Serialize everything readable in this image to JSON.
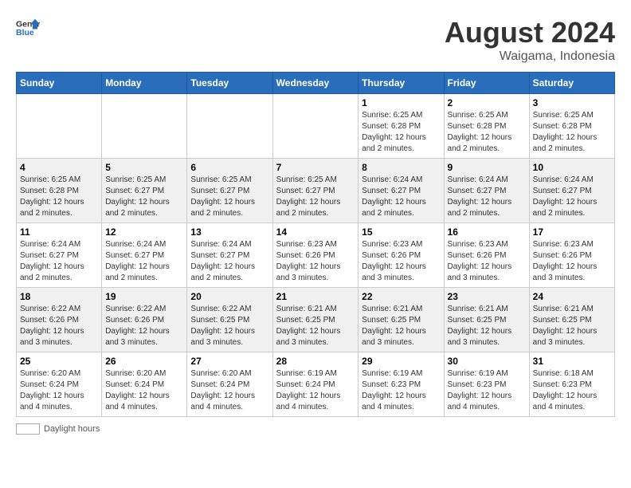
{
  "header": {
    "logo_text_general": "General",
    "logo_text_blue": "Blue",
    "month_year": "August 2024",
    "location": "Waigama, Indonesia"
  },
  "days_of_week": [
    "Sunday",
    "Monday",
    "Tuesday",
    "Wednesday",
    "Thursday",
    "Friday",
    "Saturday"
  ],
  "weeks": [
    [
      {
        "day": "",
        "sunrise": "",
        "sunset": "",
        "daylight": ""
      },
      {
        "day": "",
        "sunrise": "",
        "sunset": "",
        "daylight": ""
      },
      {
        "day": "",
        "sunrise": "",
        "sunset": "",
        "daylight": ""
      },
      {
        "day": "",
        "sunrise": "",
        "sunset": "",
        "daylight": ""
      },
      {
        "day": "1",
        "sunrise": "6:25 AM",
        "sunset": "6:28 PM",
        "daylight": "12 hours and 2 minutes."
      },
      {
        "day": "2",
        "sunrise": "6:25 AM",
        "sunset": "6:28 PM",
        "daylight": "12 hours and 2 minutes."
      },
      {
        "day": "3",
        "sunrise": "6:25 AM",
        "sunset": "6:28 PM",
        "daylight": "12 hours and 2 minutes."
      }
    ],
    [
      {
        "day": "4",
        "sunrise": "6:25 AM",
        "sunset": "6:28 PM",
        "daylight": "12 hours and 2 minutes."
      },
      {
        "day": "5",
        "sunrise": "6:25 AM",
        "sunset": "6:27 PM",
        "daylight": "12 hours and 2 minutes."
      },
      {
        "day": "6",
        "sunrise": "6:25 AM",
        "sunset": "6:27 PM",
        "daylight": "12 hours and 2 minutes."
      },
      {
        "day": "7",
        "sunrise": "6:25 AM",
        "sunset": "6:27 PM",
        "daylight": "12 hours and 2 minutes."
      },
      {
        "day": "8",
        "sunrise": "6:24 AM",
        "sunset": "6:27 PM",
        "daylight": "12 hours and 2 minutes."
      },
      {
        "day": "9",
        "sunrise": "6:24 AM",
        "sunset": "6:27 PM",
        "daylight": "12 hours and 2 minutes."
      },
      {
        "day": "10",
        "sunrise": "6:24 AM",
        "sunset": "6:27 PM",
        "daylight": "12 hours and 2 minutes."
      }
    ],
    [
      {
        "day": "11",
        "sunrise": "6:24 AM",
        "sunset": "6:27 PM",
        "daylight": "12 hours and 2 minutes."
      },
      {
        "day": "12",
        "sunrise": "6:24 AM",
        "sunset": "6:27 PM",
        "daylight": "12 hours and 2 minutes."
      },
      {
        "day": "13",
        "sunrise": "6:24 AM",
        "sunset": "6:27 PM",
        "daylight": "12 hours and 2 minutes."
      },
      {
        "day": "14",
        "sunrise": "6:23 AM",
        "sunset": "6:26 PM",
        "daylight": "12 hours and 3 minutes."
      },
      {
        "day": "15",
        "sunrise": "6:23 AM",
        "sunset": "6:26 PM",
        "daylight": "12 hours and 3 minutes."
      },
      {
        "day": "16",
        "sunrise": "6:23 AM",
        "sunset": "6:26 PM",
        "daylight": "12 hours and 3 minutes."
      },
      {
        "day": "17",
        "sunrise": "6:23 AM",
        "sunset": "6:26 PM",
        "daylight": "12 hours and 3 minutes."
      }
    ],
    [
      {
        "day": "18",
        "sunrise": "6:22 AM",
        "sunset": "6:26 PM",
        "daylight": "12 hours and 3 minutes."
      },
      {
        "day": "19",
        "sunrise": "6:22 AM",
        "sunset": "6:26 PM",
        "daylight": "12 hours and 3 minutes."
      },
      {
        "day": "20",
        "sunrise": "6:22 AM",
        "sunset": "6:25 PM",
        "daylight": "12 hours and 3 minutes."
      },
      {
        "day": "21",
        "sunrise": "6:21 AM",
        "sunset": "6:25 PM",
        "daylight": "12 hours and 3 minutes."
      },
      {
        "day": "22",
        "sunrise": "6:21 AM",
        "sunset": "6:25 PM",
        "daylight": "12 hours and 3 minutes."
      },
      {
        "day": "23",
        "sunrise": "6:21 AM",
        "sunset": "6:25 PM",
        "daylight": "12 hours and 3 minutes."
      },
      {
        "day": "24",
        "sunrise": "6:21 AM",
        "sunset": "6:25 PM",
        "daylight": "12 hours and 3 minutes."
      }
    ],
    [
      {
        "day": "25",
        "sunrise": "6:20 AM",
        "sunset": "6:24 PM",
        "daylight": "12 hours and 4 minutes."
      },
      {
        "day": "26",
        "sunrise": "6:20 AM",
        "sunset": "6:24 PM",
        "daylight": "12 hours and 4 minutes."
      },
      {
        "day": "27",
        "sunrise": "6:20 AM",
        "sunset": "6:24 PM",
        "daylight": "12 hours and 4 minutes."
      },
      {
        "day": "28",
        "sunrise": "6:19 AM",
        "sunset": "6:24 PM",
        "daylight": "12 hours and 4 minutes."
      },
      {
        "day": "29",
        "sunrise": "6:19 AM",
        "sunset": "6:23 PM",
        "daylight": "12 hours and 4 minutes."
      },
      {
        "day": "30",
        "sunrise": "6:19 AM",
        "sunset": "6:23 PM",
        "daylight": "12 hours and 4 minutes."
      },
      {
        "day": "31",
        "sunrise": "6:18 AM",
        "sunset": "6:23 PM",
        "daylight": "12 hours and 4 minutes."
      }
    ]
  ],
  "footer": {
    "daylight_hours_label": "Daylight hours"
  }
}
